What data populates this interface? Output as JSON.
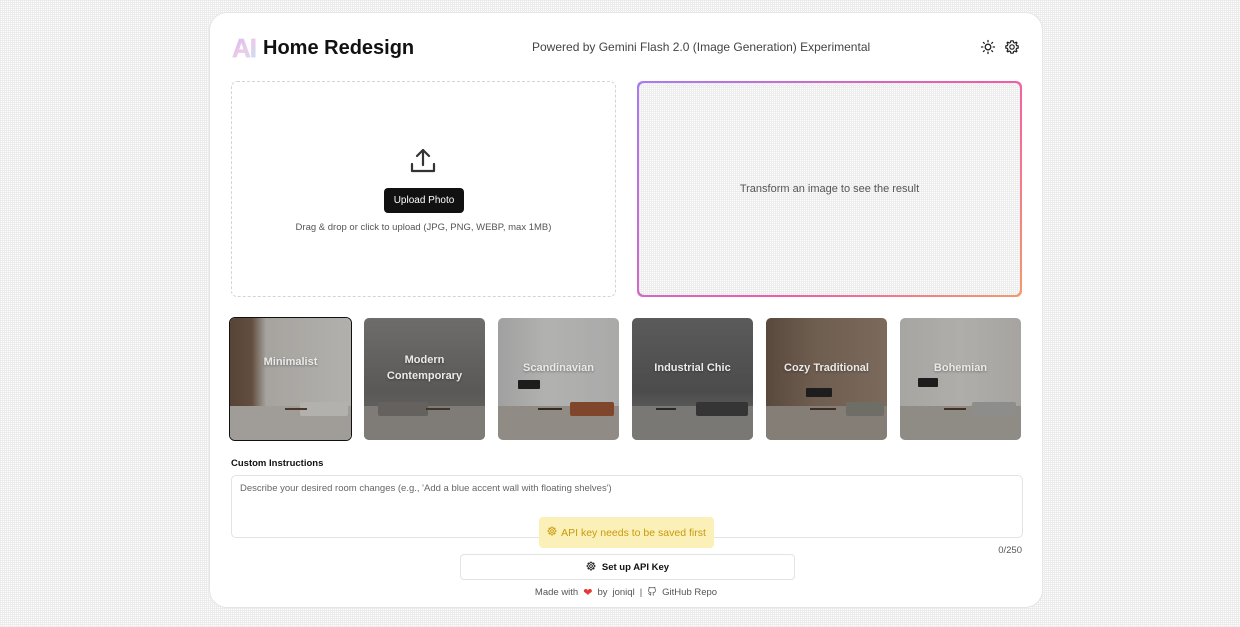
{
  "header": {
    "logo_mark": "AI",
    "title": "Home Redesign",
    "powered_by": "Powered by Gemini Flash 2.0 (Image Generation) Experimental"
  },
  "upload": {
    "button_label": "Upload Photo",
    "hint": "Drag & drop or click to upload (JPG, PNG, WEBP, max 1MB)"
  },
  "result": {
    "placeholder": "Transform an image to see the result"
  },
  "styles": [
    {
      "label": "Minimalist",
      "selected": true
    },
    {
      "label": "Modern Contemporary",
      "selected": false
    },
    {
      "label": "Scandinavian",
      "selected": false
    },
    {
      "label": "Industrial Chic",
      "selected": false
    },
    {
      "label": "Cozy Traditional",
      "selected": false
    },
    {
      "label": "Bohemian",
      "selected": false
    }
  ],
  "custom_instructions": {
    "label": "Custom Instructions",
    "placeholder": "Describe your desired room changes (e.g., 'Add a blue accent wall with floating shelves')",
    "value": "",
    "char_count": "0/250"
  },
  "api_warning": "API key needs to be saved first",
  "setup_button_label": "Set up API Key",
  "footer": {
    "made_with": "Made with",
    "by": "by",
    "author": "joniql",
    "separator": "|",
    "repo_link": "GitHub Repo"
  },
  "colors": {
    "primary_button": "#111111",
    "warning_bg": "#fbf0b8",
    "warning_text": "#c99a0c",
    "heart": "#e53935"
  }
}
